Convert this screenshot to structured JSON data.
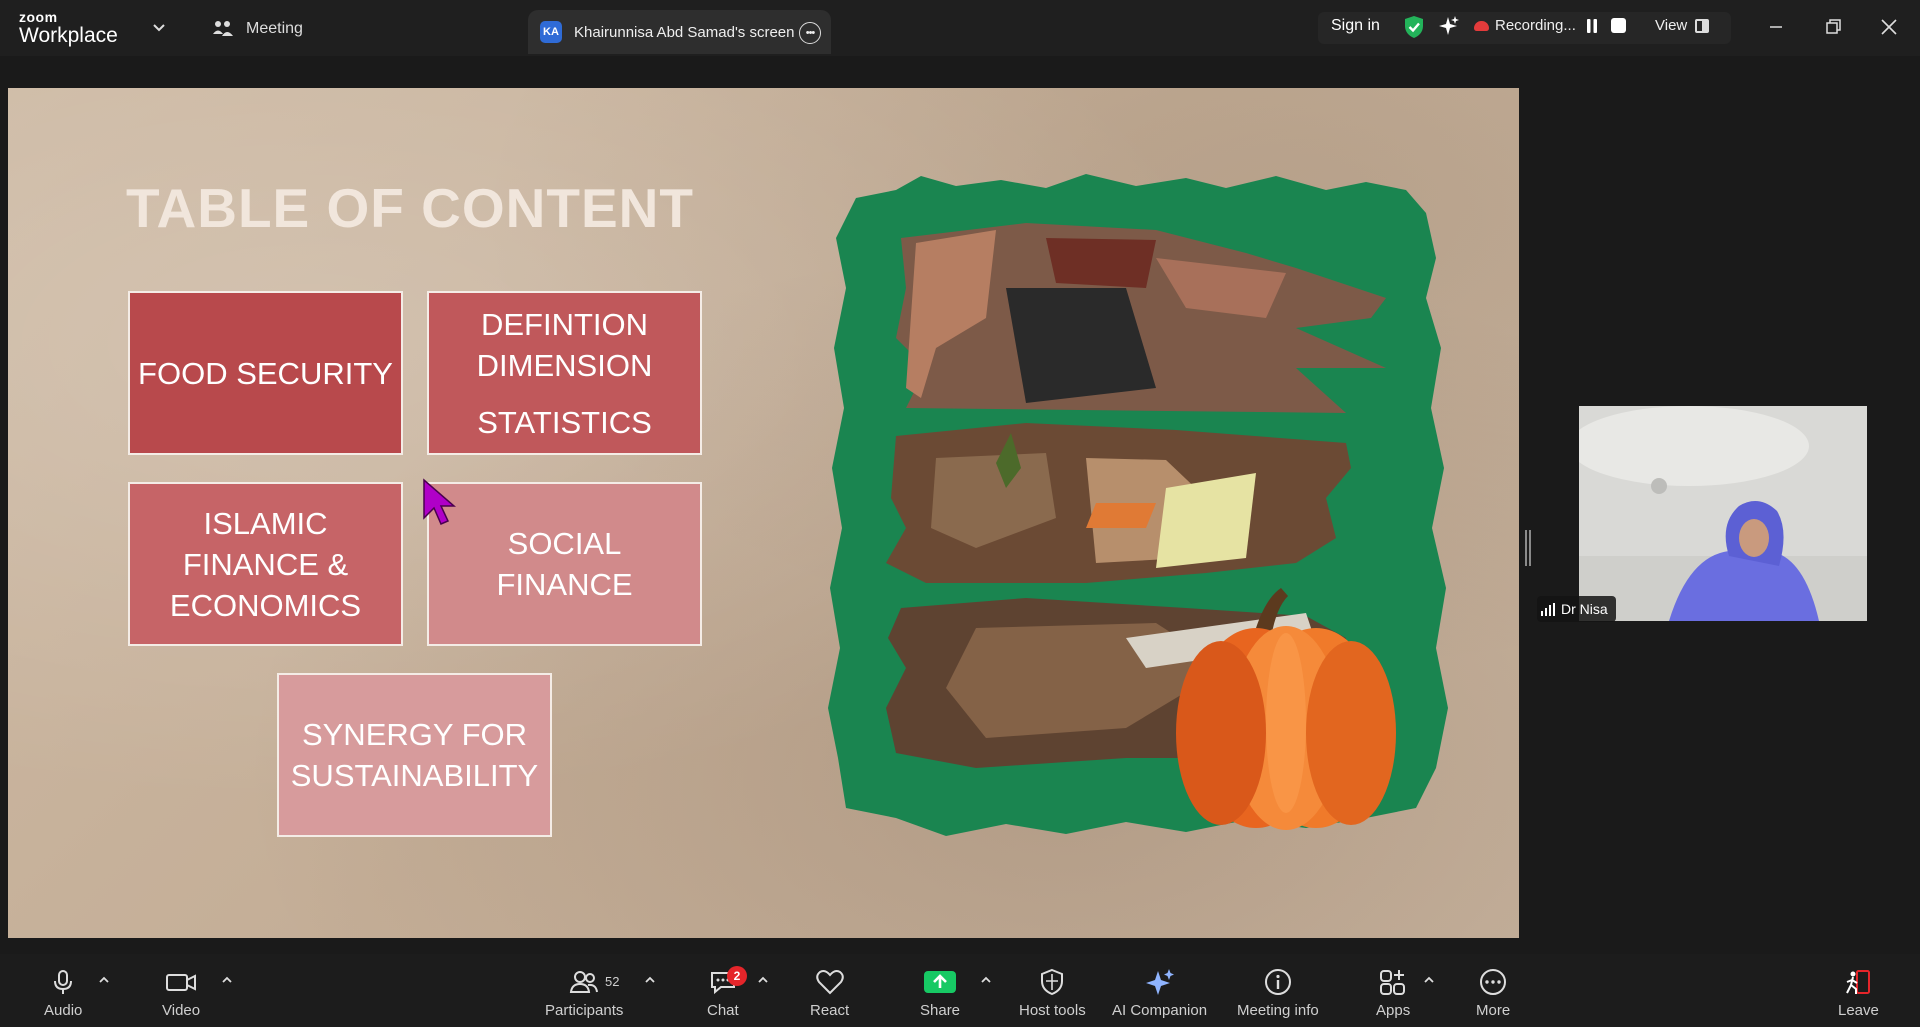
{
  "app": {
    "brand_small": "zoom",
    "brand_large": "Workplace"
  },
  "tabs": {
    "meeting": "Meeting",
    "share_initials": "KA",
    "share_title": "Khairunnisa Abd Samad's screen"
  },
  "header": {
    "sign_in": "Sign in",
    "recording": "Recording...",
    "view": "View"
  },
  "slide": {
    "title": "TABLE OF CONTENT",
    "boxes": {
      "food_security": "FOOD SECURITY",
      "defintion_l1": "DEFINTION",
      "defintion_l2": "DIMENSION",
      "defintion_l3": "STATISTICS",
      "islamic_l1": "ISLAMIC",
      "islamic_l2": "FINANCE &",
      "islamic_l3": "ECONOMICS",
      "social_l1": "SOCIAL",
      "social_l2": "FINANCE",
      "synergy_l1": "SYNERGY FOR",
      "synergy_l2": "SUSTAINABILITY"
    },
    "box_colors": {
      "food_security": "#b8494c",
      "defintion": "#c0585b",
      "islamic": "#c66467",
      "social": "#d18a8b",
      "synergy": "#d79b9c"
    },
    "frame_color": "#1a8550"
  },
  "participant": {
    "name": "Dr Nisa"
  },
  "toolbar": {
    "audio": "Audio",
    "video": "Video",
    "participants": "Participants",
    "participants_count": "52",
    "chat": "Chat",
    "chat_badge": "2",
    "react": "React",
    "share": "Share",
    "host_tools": "Host tools",
    "ai_companion": "AI Companion",
    "meeting_info": "Meeting info",
    "apps": "Apps",
    "more": "More",
    "leave": "Leave"
  },
  "colors": {
    "share_green": "#17c964",
    "leave_red": "#e5252a",
    "recording_red": "#e33b3b",
    "secure_green": "#23b35a"
  }
}
